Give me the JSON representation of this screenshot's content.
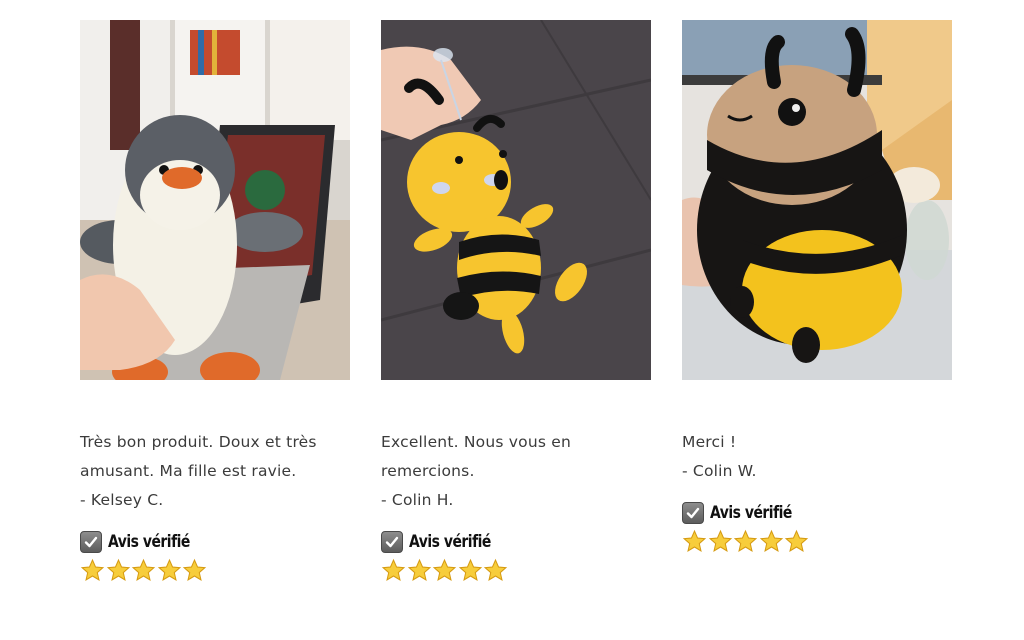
{
  "reviews": [
    {
      "photo": "penguin-plush-photo",
      "lines": [
        "Très bon produit. Doux et très",
        "amusant. Ma fille est ravie.",
        "- Kelsey C."
      ],
      "badge_label": "Avis vérifié",
      "rating": 5,
      "max_rating": 5
    },
    {
      "photo": "bee-plush-photo",
      "lines": [
        "Excellent. Nous vous en",
        "remercions.",
        "- Colin H."
      ],
      "badge_label": "Avis vérifié",
      "rating": 5,
      "max_rating": 5
    },
    {
      "photo": "bumblebee-plush-photo",
      "lines": [
        "Merci !",
        "- Colin W."
      ],
      "badge_label": "Avis vérifié",
      "rating": 5,
      "max_rating": 5
    }
  ],
  "colors": {
    "background": "#ffffff",
    "text": "#3b3b3b",
    "star": "#f5c518"
  }
}
